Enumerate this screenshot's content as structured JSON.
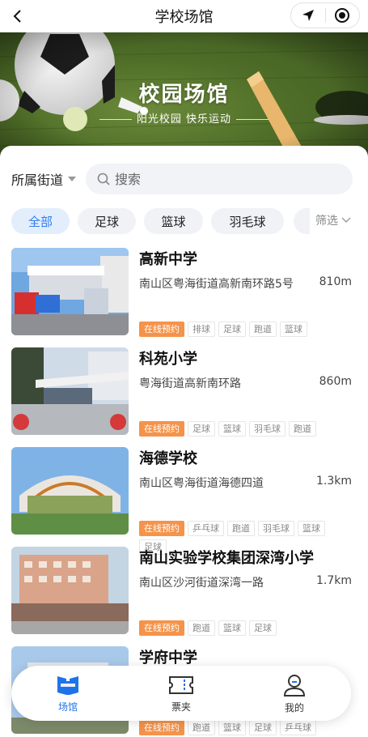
{
  "nav": {
    "title": "学校场馆",
    "back_icon": "chevron-left-icon",
    "location_icon": "navigation-arrow-icon",
    "record_icon": "target-circle-icon"
  },
  "banner": {
    "title": "校园场馆",
    "subtitle": "阳光校园  快乐运动"
  },
  "filters": {
    "district_label": "所属街道",
    "search_placeholder": "搜索"
  },
  "tabs": [
    {
      "label": "全部",
      "active": true
    },
    {
      "label": "足球",
      "active": false
    },
    {
      "label": "篮球",
      "active": false
    },
    {
      "label": "羽毛球",
      "active": false
    }
  ],
  "filter_button": "筛选",
  "venues": [
    {
      "name": "高新中学",
      "address": "南山区粤海街道高新南环路5号",
      "distance": "810m",
      "booking": "在线预约",
      "tags": [
        "排球",
        "足球",
        "跑道",
        "篮球"
      ]
    },
    {
      "name": "科苑小学",
      "address": "粤海街道高新南环路",
      "distance": "860m",
      "booking": "在线预约",
      "tags": [
        "足球",
        "篮球",
        "羽毛球",
        "跑道"
      ]
    },
    {
      "name": "海德学校",
      "address": "南山区粤海街道海德四道",
      "distance": "1.3km",
      "booking": "在线预约",
      "tags": [
        "乒乓球",
        "跑道",
        "羽毛球",
        "篮球",
        "足球"
      ]
    },
    {
      "name": "南山实验学校集团深湾小学",
      "address": "南山区沙河街道深湾一路",
      "distance": "1.7km",
      "booking": "在线预约",
      "tags": [
        "跑道",
        "篮球",
        "足球"
      ]
    },
    {
      "name": "学府中学",
      "address": "",
      "distance": "",
      "booking": "在线预约",
      "tags": [
        "跑道",
        "篮球",
        "足球",
        "乒乓球"
      ]
    }
  ],
  "tabbar": [
    {
      "label": "场馆",
      "icon": "venue-book-icon",
      "active": true
    },
    {
      "label": "票夹",
      "icon": "ticket-icon",
      "active": false
    },
    {
      "label": "我的",
      "icon": "user-profile-icon",
      "active": false
    }
  ],
  "colors": {
    "accent": "#2f7ef0",
    "booking": "#f5934a",
    "tab_active_bg": "#e3eefc"
  }
}
